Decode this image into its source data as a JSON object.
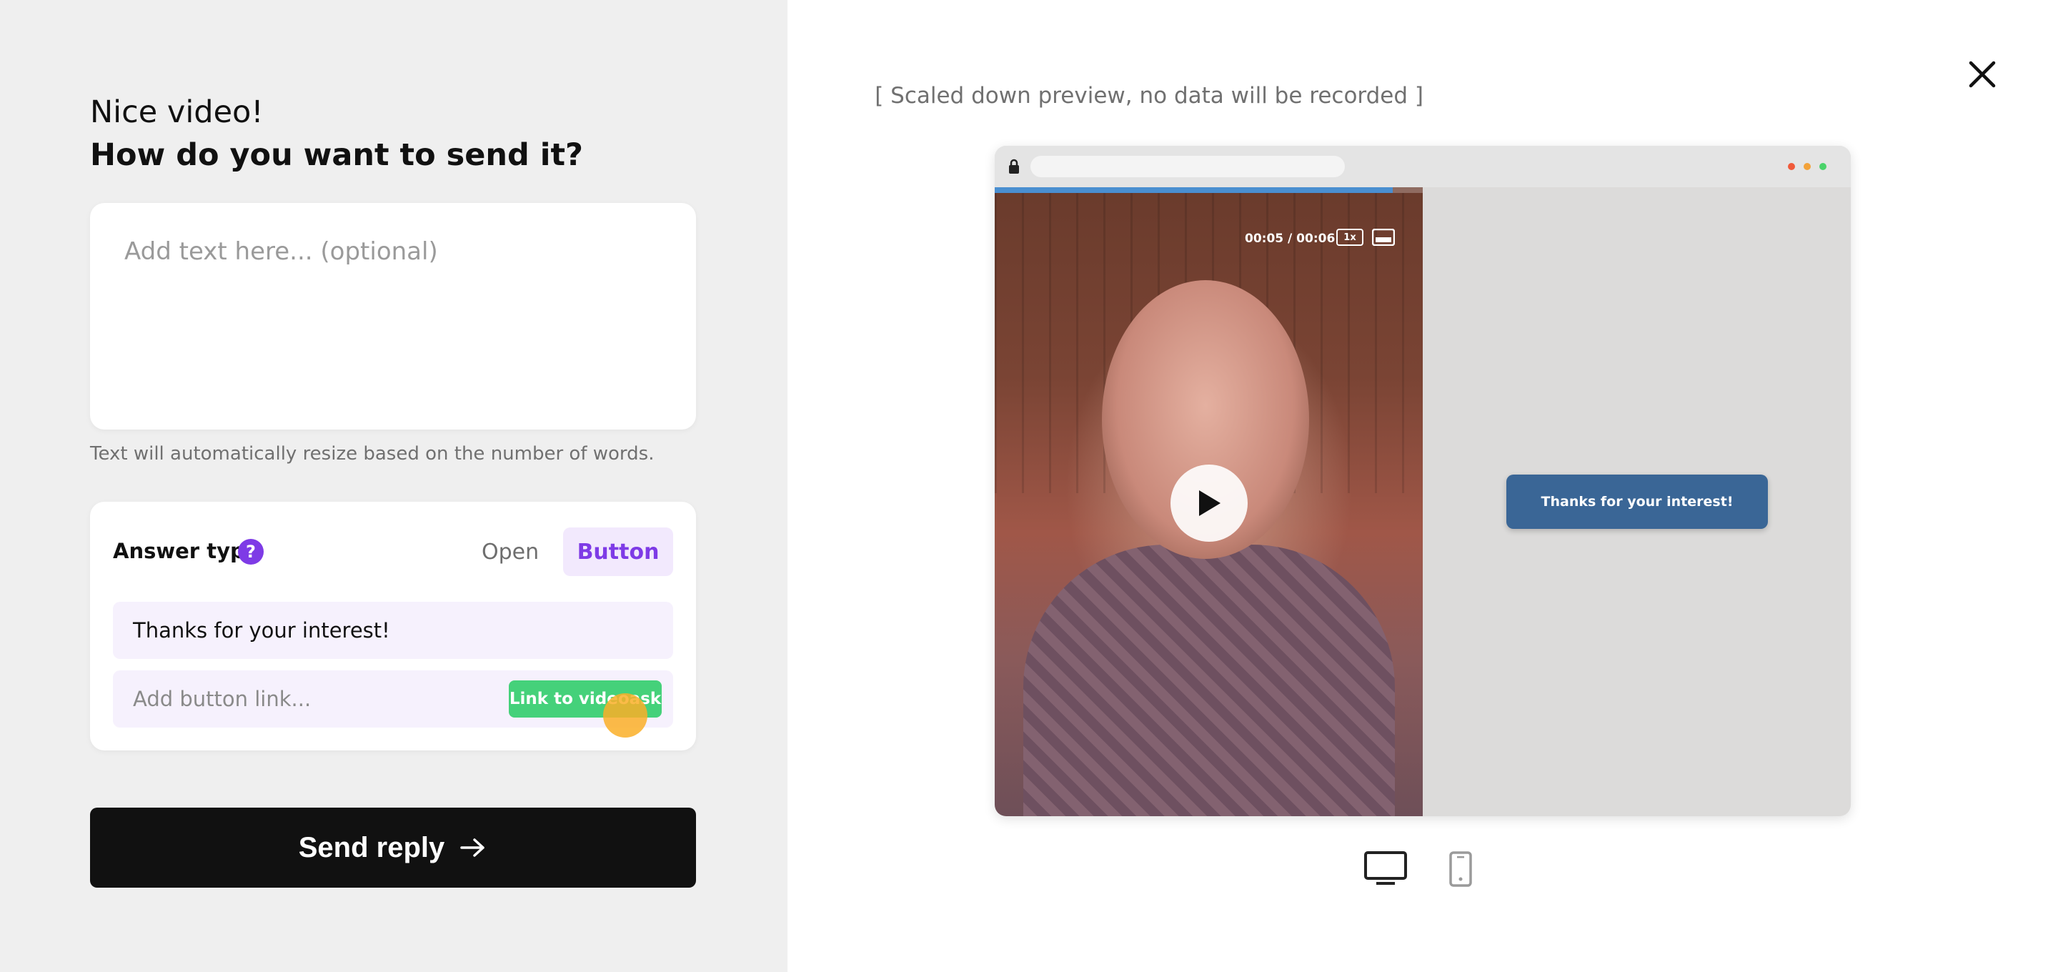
{
  "left": {
    "heading_line1": "Nice video!",
    "heading_line2": "How do you want to send it?",
    "text_placeholder": "Add text here... (optional)",
    "helper_text": "Text will automatically resize based on the number of words.",
    "answer_type": {
      "label": "Answer type",
      "help_glyph": "?",
      "options": [
        "Open",
        "Button"
      ],
      "selected": "Button",
      "button_text": "Thanks for your interest!",
      "link_placeholder": "Add button link...",
      "link_chip_label": "Link to videoask"
    },
    "send_button_label": "Send reply"
  },
  "right": {
    "preview_note": "[ Scaled down preview, no data will be recorded ]",
    "video": {
      "time": "00:05 / 00:06",
      "speed": "1x",
      "progress": 0.93
    },
    "cta_button_label": "Thanks for your interest!",
    "devices": [
      "desktop",
      "mobile"
    ],
    "selected_device": "desktop"
  },
  "colors": {
    "accent_purple": "#7e3be6",
    "chip_green": "#45d17a",
    "cta_blue": "#3a6696",
    "send_black": "#111111"
  }
}
